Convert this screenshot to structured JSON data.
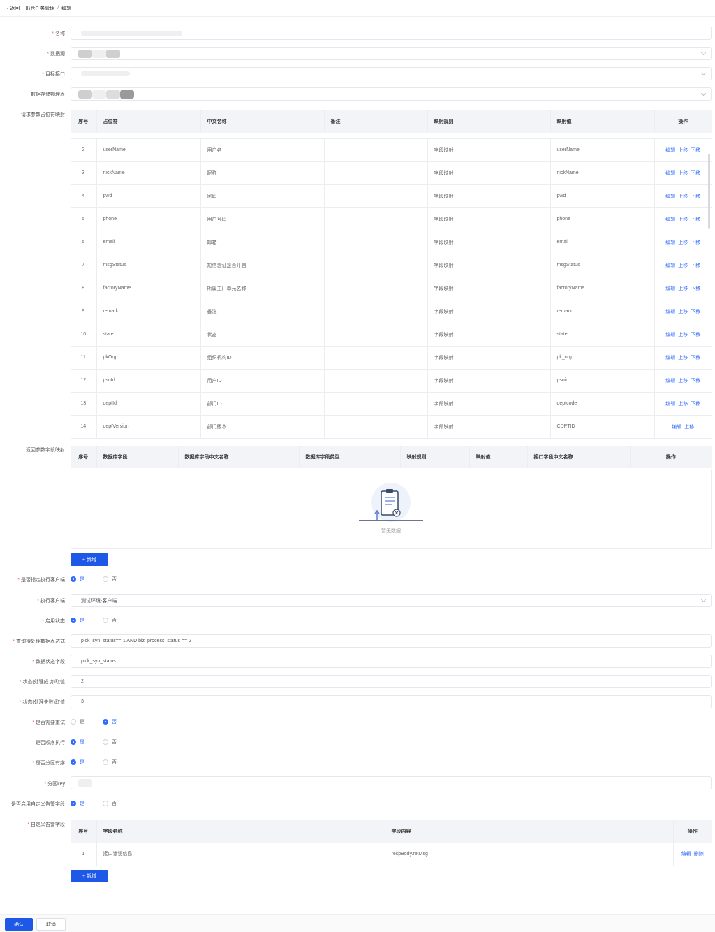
{
  "header": {
    "back": "返回",
    "crumb1": "出仓任务管理",
    "crumb_sep": "/",
    "crumb2": "编辑"
  },
  "form": {
    "name_label": "名称",
    "datasource_label": "数据源",
    "target_api_label": "目标接口",
    "storage_table_label": "数据存储物理表",
    "request_map_label": "请求参数占位符映射",
    "return_map_label": "返回参数字段映射",
    "specify_client_label": "是否指定执行客户端",
    "exec_client_label": "执行客户端",
    "exec_client_value": "测试环境-客户端",
    "enable_label": "启用状态",
    "query_expr_label": "查询待处理数据表达式",
    "query_expr_value": "pick_syn_status== 1 AND biz_process_status == 2",
    "status_field_label": "数据状态字段",
    "status_field_value": "pick_syn_status",
    "success_label": "状态(处理成功)取值",
    "success_value": "2",
    "fail_label": "状态(处理失败)取值",
    "fail_value": "3",
    "retry_label": "是否需要重试",
    "order_label": "是否顺序执行",
    "partition_order_label": "是否分区有序",
    "partition_key_label": "分区key",
    "custom_alarm_label": "是否启用自定义告警字段",
    "custom_alarm_fields_label": "自定义告警字段",
    "yes": "是",
    "no": "否"
  },
  "request_table": {
    "headers": [
      "序号",
      "占位符",
      "中文名称",
      "备注",
      "映射规则",
      "映射值",
      "操作"
    ],
    "rows": [
      {
        "no": "2",
        "ph": "userName",
        "cn": "用户名",
        "note": "",
        "rule": "字段映射",
        "val": "userName"
      },
      {
        "no": "3",
        "ph": "nickName",
        "cn": "昵称",
        "note": "",
        "rule": "字段映射",
        "val": "nickName"
      },
      {
        "no": "4",
        "ph": "pwd",
        "cn": "密码",
        "note": "",
        "rule": "字段映射",
        "val": "pwd"
      },
      {
        "no": "5",
        "ph": "phone",
        "cn": "用户号码",
        "note": "",
        "rule": "字段映射",
        "val": "phone"
      },
      {
        "no": "6",
        "ph": "email",
        "cn": "邮箱",
        "note": "",
        "rule": "字段映射",
        "val": "email"
      },
      {
        "no": "7",
        "ph": "msgStatus",
        "cn": "短信验证是否开启",
        "note": "",
        "rule": "字段映射",
        "val": "msgStatus"
      },
      {
        "no": "8",
        "ph": "factoryName",
        "cn": "所属工厂单元名称",
        "note": "",
        "rule": "字段映射",
        "val": "factoryName"
      },
      {
        "no": "9",
        "ph": "remark",
        "cn": "备注",
        "note": "",
        "rule": "字段映射",
        "val": "remark"
      },
      {
        "no": "10",
        "ph": "state",
        "cn": "状态",
        "note": "",
        "rule": "字段映射",
        "val": "state"
      },
      {
        "no": "11",
        "ph": "pkOrg",
        "cn": "组织机构ID",
        "note": "",
        "rule": "字段映射",
        "val": "pk_org"
      },
      {
        "no": "12",
        "ph": "psnId",
        "cn": "用户ID",
        "note": "",
        "rule": "字段映射",
        "val": "psnid"
      },
      {
        "no": "13",
        "ph": "deptId",
        "cn": "部门ID",
        "note": "",
        "rule": "字段映射",
        "val": "deptcode"
      },
      {
        "no": "14",
        "ph": "deptVersion",
        "cn": "部门版本",
        "note": "",
        "rule": "字段映射",
        "val": "CDPTID"
      }
    ],
    "actions": {
      "edit": "编辑",
      "up": "上移",
      "down": "下移"
    }
  },
  "return_table": {
    "headers": [
      "序号",
      "数据库字段",
      "数据库字段中文名称",
      "数据库字段类型",
      "映射规则",
      "映射值",
      "接口字段中文名称",
      "操作"
    ],
    "empty_text": "暂无数据"
  },
  "add_button": "+ 新增",
  "alarm_table": {
    "headers": [
      "序号",
      "字段名称",
      "字段内容",
      "操作"
    ],
    "rows": [
      {
        "no": "1",
        "name": "接口错误信息",
        "content": "respBody.retMsg"
      }
    ],
    "actions": {
      "edit": "编辑",
      "delete": "删除"
    }
  },
  "footer": {
    "ok": "确认",
    "cancel": "取消"
  },
  "colors": {
    "primary": "#1d58e6",
    "link": "#2f6bff",
    "required": "#f56c6c"
  }
}
